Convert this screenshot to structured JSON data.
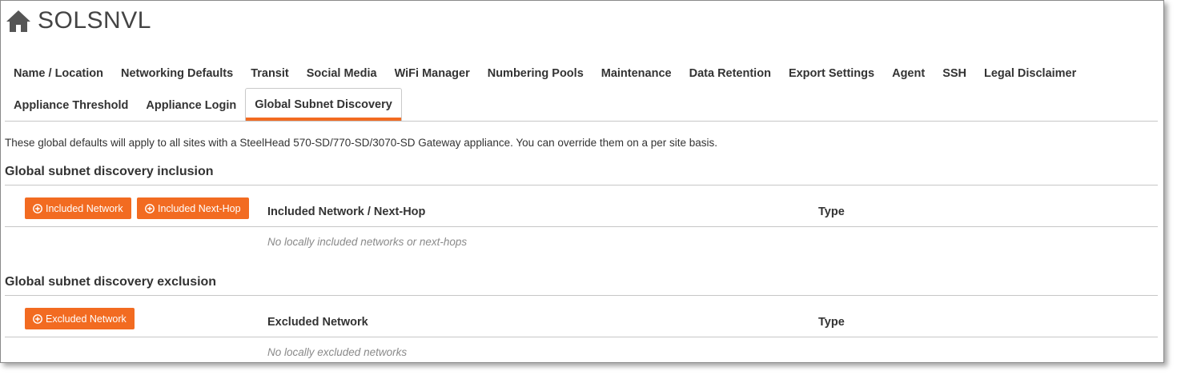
{
  "header": {
    "site_name": "SOLSNVL",
    "icon": "home-icon"
  },
  "tabs": [
    {
      "label": "Name / Location",
      "active": false
    },
    {
      "label": "Networking Defaults",
      "active": false
    },
    {
      "label": "Transit",
      "active": false
    },
    {
      "label": "Social Media",
      "active": false
    },
    {
      "label": "WiFi Manager",
      "active": false
    },
    {
      "label": "Numbering Pools",
      "active": false
    },
    {
      "label": "Maintenance",
      "active": false
    },
    {
      "label": "Data Retention",
      "active": false
    },
    {
      "label": "Export Settings",
      "active": false
    },
    {
      "label": "Agent",
      "active": false
    },
    {
      "label": "SSH",
      "active": false
    },
    {
      "label": "Legal Disclaimer",
      "active": false
    },
    {
      "label": "Appliance Threshold",
      "active": false
    },
    {
      "label": "Appliance Login",
      "active": false
    },
    {
      "label": "Global Subnet Discovery",
      "active": true
    }
  ],
  "intro_text": "These global defaults will apply to all sites with a SteelHead 570-SD/770-SD/3070-SD Gateway appliance. You can override them on a per site basis.",
  "inclusion": {
    "title": "Global subnet discovery inclusion",
    "btn_network": "Included Network",
    "btn_nexthop": "Included Next-Hop",
    "col_name": "Included Network / Next-Hop",
    "col_type": "Type",
    "empty_text": "No locally included networks or next-hops"
  },
  "exclusion": {
    "title": "Global subnet discovery exclusion",
    "btn_network": "Excluded Network",
    "col_name": "Excluded Network",
    "col_type": "Type",
    "empty_text": "No locally excluded networks"
  },
  "colors": {
    "accent": "#f26b21",
    "text": "#333333",
    "muted": "#8a8a8a",
    "divider": "#c7c7c7"
  }
}
